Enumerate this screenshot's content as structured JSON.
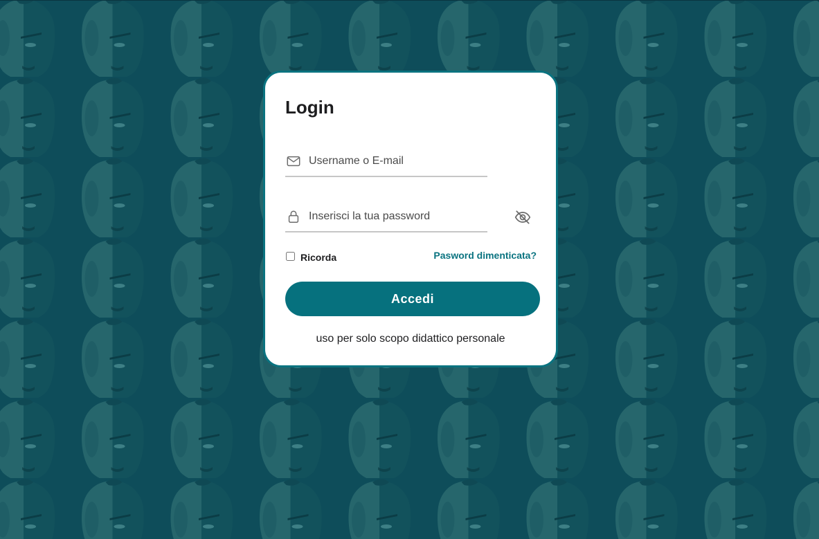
{
  "background": {
    "color": "#0e4d5a",
    "pattern_icon": "face-silhouette-icon"
  },
  "login": {
    "title": "Login",
    "username": {
      "icon": "mail-icon",
      "placeholder": "Username o E-mail",
      "value": ""
    },
    "password": {
      "icon": "lock-icon",
      "placeholder": "Inserisci la tua password",
      "value": "",
      "toggle_icon": "eye-off-icon"
    },
    "remember_label": "Ricorda",
    "remember_checked": false,
    "forgot_label": "Pasword dimenticata?",
    "submit_label": "Accedi",
    "disclaimer": "uso per solo scopo didattico personale"
  },
  "colors": {
    "accent": "#06717e",
    "card_border": "#0a7380",
    "link": "#0a7380"
  }
}
